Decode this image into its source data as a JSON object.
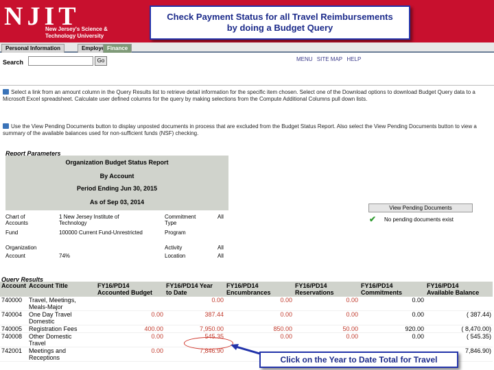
{
  "header": {
    "logo_text": "NJIT",
    "logo_subtitle": "New Jersey's Science &\nTechnology University",
    "callout": "Check Payment Status for all Travel Reimbursements\nby doing a Budget Query"
  },
  "tabs": [
    {
      "label": "Personal Information"
    },
    {
      "label": "Employee"
    },
    {
      "label": "Finance"
    }
  ],
  "search": {
    "label": "Search",
    "value": "",
    "button": "Go"
  },
  "top_links": [
    "MENU",
    "SITE MAP",
    "HELP"
  ],
  "info": [
    "Select a link from an amount column in the Query Results list to retrieve detail information for the specific item chosen. Select one of the Download options to download Budget Query data to a Microsoft Excel spreadsheet. Calculate user defined columns for the query by making selections from the Compute Additional Columns pull down lists.",
    "Use the View Pending Documents button to display unposted documents in process that are excluded from the Budget Status Report. Also select the View Pending Documents button to view a summary of the available balances used for non-sufficient funds (NSF) checking."
  ],
  "report_parameters": {
    "title": "Report Parameters",
    "lines": [
      "Organization Budget Status Report",
      "By Account",
      "Period Ending Jun 30, 2015",
      "As of Sep 03, 2014"
    ],
    "params": {
      "chart_label": "Chart of\nAccounts",
      "chart_value": "1 New Jersey Institute of\nTechnology",
      "commitment_label": "Commitment\nType",
      "commitment_value": "All",
      "fund_label": "Fund",
      "fund_value": "100000 Current Fund-Unrestricted",
      "program_label": "Program",
      "organization_label": "Organization",
      "activity_label": "Activity",
      "activity_value": "All",
      "account_label": "Account",
      "account_value": "74%",
      "location_label": "Location",
      "location_value": "All"
    }
  },
  "pending": {
    "button": "View Pending Documents",
    "note": "No pending documents exist"
  },
  "query_results": {
    "title": "Query Results",
    "columns": [
      "Account",
      "Account Title",
      "FY16/PD14\nAccounted Budget",
      "FY16/PD14 Year\nto Date",
      "FY16/PD14\nEncumbrances",
      "FY16/PD14\nReservations",
      "FY16/PD14\nCommitments",
      "FY16/PD14\nAvailable Balance"
    ],
    "rows": [
      {
        "account": "740000",
        "title": "Travel, Meetings,\nMeals-Major",
        "budget": "",
        "ytd": "0.00",
        "enc": "0.00",
        "res": "0.00",
        "com": "0.00",
        "avail": ""
      },
      {
        "account": "740004",
        "title": "One Day Travel\nDomestic",
        "budget": "0.00",
        "ytd": "387.44",
        "enc": "0.00",
        "res": "0.00",
        "com": "0.00",
        "avail": "( 387.44)"
      },
      {
        "account": "740005",
        "title": "Registration Fees",
        "budget": "400.00",
        "ytd": "7,950.00",
        "enc": "850.00",
        "res": "50.00",
        "com": "920.00",
        "avail": "( 8,470.00)"
      },
      {
        "account": "740008",
        "title": "Other Domestic\nTravel",
        "budget": "0.00",
        "ytd": "545.35",
        "enc": "0.00",
        "res": "0.00",
        "com": "0.00",
        "avail": "( 545.35)"
      },
      {
        "account": "742001",
        "title": "Meetings and\nReceptions",
        "budget": "0.00",
        "ytd": "7,846.90",
        "enc": "",
        "res": "",
        "com": "",
        "avail": "7,846.90)"
      }
    ]
  },
  "callout_bottom": "Click on the Year to Date Total for Travel",
  "colors": {
    "header_red": "#c8102e",
    "callout_blue": "#1b2a8a",
    "table_header": "#d0d3cc"
  }
}
